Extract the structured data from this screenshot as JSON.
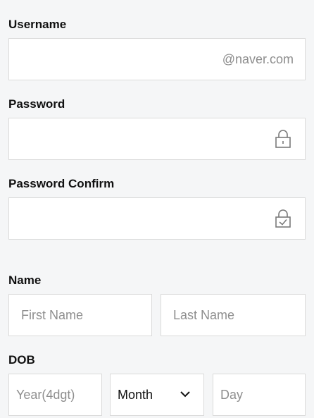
{
  "username": {
    "label": "Username",
    "value": "",
    "suffix": "@naver.com"
  },
  "password": {
    "label": "Password",
    "value": "",
    "icon": "lock-icon"
  },
  "password_confirm": {
    "label": "Password Confirm",
    "value": "",
    "icon": "lock-check-icon"
  },
  "name": {
    "label": "Name",
    "first_placeholder": "First Name",
    "last_placeholder": "Last Name"
  },
  "dob": {
    "label": "DOB",
    "year_placeholder": "Year(4dgt)",
    "month_selected": "Month",
    "day_placeholder": "Day"
  },
  "colors": {
    "background": "#f5f6f7",
    "border": "#dadada",
    "placeholder": "#8e8e8e",
    "label": "#111111"
  }
}
